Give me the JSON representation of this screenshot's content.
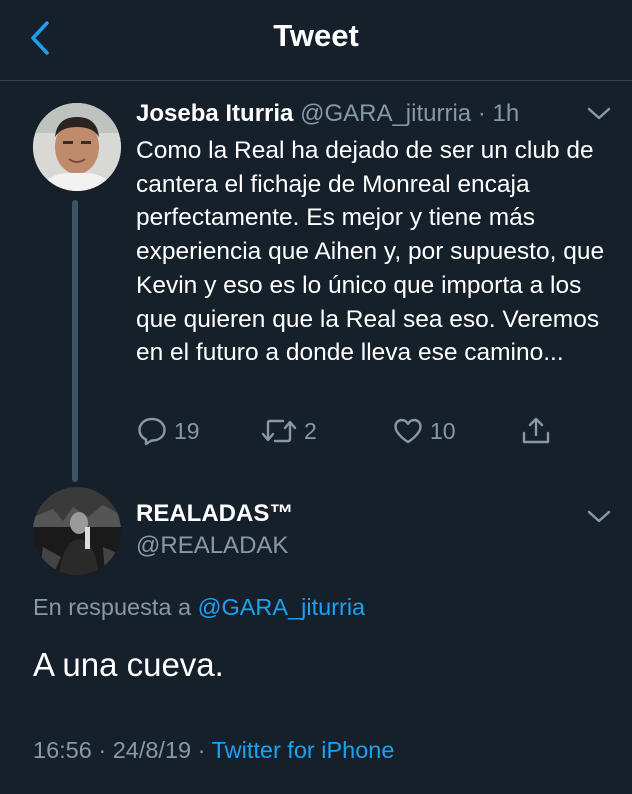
{
  "header": {
    "title": "Tweet"
  },
  "parent_tweet": {
    "author_name": "Joseba Iturria",
    "handle_time": "@GARA_jiturria · 1h",
    "text": "Como la Real ha dejado de ser un club de cantera el fichaje de Monreal encaja perfectamente. Es mejor y tiene más experiencia que Aihen y, por supuesto, que Kevin y eso es lo único que importa a los que quieren que la Real sea eso. Veremos en el futuro a donde lleva ese camino...",
    "reply_count": "19",
    "retweet_count": "2",
    "like_count": "10",
    "icons": [
      "reply-icon",
      "retweet-icon",
      "like-icon",
      "share-icon",
      "chevron-down-icon"
    ]
  },
  "reply_tweet": {
    "author_name": "REALADAS™",
    "handle": "@REALADAK",
    "reply_prefix": "En respuesta a",
    "reply_mention": "@GARA_jiturria",
    "text": "A una cueva.",
    "timestamp": "16:56 · 24/8/19 ·",
    "source": "Twitter for iPhone"
  },
  "colors": {
    "background": "#15202b",
    "accent": "#1da1f2",
    "secondary_text": "#8899a6",
    "divider": "#38444d"
  }
}
